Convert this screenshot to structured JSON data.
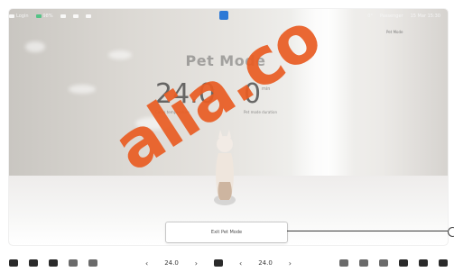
{
  "status_bar": {
    "left": [
      {
        "icon": "user-icon",
        "label": "Login"
      },
      {
        "icon": "battery-icon",
        "label": "98%"
      },
      {
        "icon": "bluetooth-icon",
        "label": ""
      },
      {
        "icon": "lock-icon",
        "label": ""
      },
      {
        "icon": "wifi-icon",
        "label": ""
      }
    ],
    "right": {
      "weather": "0°",
      "profile": "Passenger",
      "time": "15 Mar 15:30"
    }
  },
  "scene": {
    "subtitle_right": "Pet Mode",
    "title": "Pet Mode",
    "temperature": {
      "value": "24.0",
      "unit": "°C",
      "label": "Cabin temperature"
    },
    "timer": {
      "value": "0",
      "unit": "min",
      "label": "Pet mode duration"
    },
    "accent_color": "#2d79d6"
  },
  "actions": {
    "exit_label": "Exit Pet Mode"
  },
  "dock": {
    "left_temp": "24.0",
    "right_temp": "24.0",
    "left_icons": [
      "car-icon",
      "camera-icon",
      "media-icon",
      "seat-icon",
      "phone-icon"
    ],
    "right_icons": [
      "phone-icon",
      "fan-icon",
      "climate-icon",
      "music-icon",
      "apps-icon",
      "volume-icon"
    ]
  },
  "watermark": {
    "text": "alia.co"
  }
}
